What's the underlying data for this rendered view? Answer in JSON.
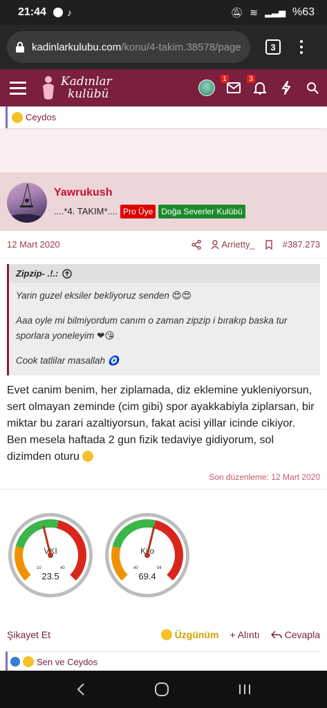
{
  "status": {
    "time": "21:44",
    "battery": "%63"
  },
  "browser": {
    "url_host": "kadinlarkulubu.com",
    "url_path": "/konu/4-takim.38578/page",
    "tab_count": "3"
  },
  "site": {
    "logo_line1": "Kadınlar",
    "logo_line2": "kulübü",
    "badges": {
      "messages": "1",
      "alerts": "3"
    }
  },
  "prev_post": {
    "reactions_text": "Ceydos"
  },
  "post": {
    "author": "Yawrukush",
    "title": "....*4. TAKIM*....",
    "tag_pro": "Pro Üye",
    "tag_club": "Doğa Severler Kulübü",
    "date": "12 Mart 2020",
    "reply_to": "Arrietty_",
    "post_number": "#387.273",
    "quote": {
      "author": "Zipzip- .!.:",
      "line1": "Yarin guzel eksiler bekliyoruz senden",
      "line2": "Aaa oyle mi bilmiyordum canım o zaman zipzip i bırakıp baska tur sporlara yoneleyim",
      "line3": "Cook tatlilar masallah"
    },
    "body_p1": "Evet canim benim, her ziplamada, diz eklemine yukleniyorsun, sert olmayan zeminde (cim gibi) spor ayakkabiyla ziplarsan, bir miktar bu zarari azaltiyorsun, fakat acisi yillar icinde cikiyor.",
    "body_p2": "Ben mesela haftada 2 gun fizik tedaviye gidiyorum, sol dizimden oturu",
    "edited": "Son düzenleme: 12 Mart 2020",
    "gauges": [
      {
        "label": "VKI",
        "value": "23.5",
        "min": "10",
        "max": "40",
        "fraction": 0.45
      },
      {
        "label": "Kilo",
        "value": "69.4",
        "min": "40",
        "max": "94",
        "fraction": 0.55
      }
    ],
    "actions": {
      "report": "Şikayet Et",
      "reaction": "Üzgünüm",
      "quote": "+ Alıntı",
      "reply": "Cevapla"
    },
    "reactions_text": "Sen ve Ceydos"
  }
}
